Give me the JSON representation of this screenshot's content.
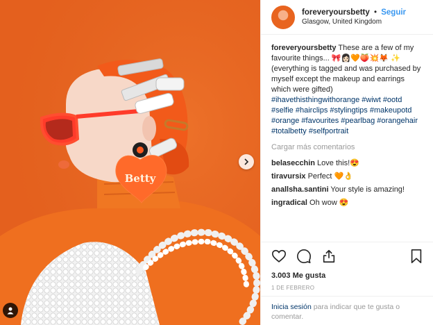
{
  "header": {
    "username": "foreveryoursbetty",
    "separator": "•",
    "follow_label": "Seguir",
    "location": "Glasgow, United Kingdom"
  },
  "caption": {
    "username": "foreveryoursbetty",
    "text": "These are a few of my favourite things... 🎀👩🏻🧡🍑💥🦊 ✨ (everything is tagged and was purchased by myself except the makeup and earrings which were gifted)",
    "hashtags": "#ihavethisthingwithorange #wiwt #ootd #selfie #hairclips #stylingtips #makeupotd #orange #favourites #pearlbag #orangehair #totalbetty #selfportrait"
  },
  "load_more_label": "Cargar más comentarios",
  "comments": [
    {
      "user": "belasecchin",
      "text": "Love this!😍"
    },
    {
      "user": "tiravursix",
      "text": "Perfect 🧡👌"
    },
    {
      "user": "anallsha.santini",
      "text": "Your style is amazing!"
    },
    {
      "user": "ingradical",
      "text": "Oh wow 😍"
    }
  ],
  "likes": "3.003 Me gusta",
  "date": "1 DE FEBRERO",
  "login": {
    "link": "Inicia sesión",
    "rest": " para indicar que te gusta o comentar."
  },
  "photo": {
    "earring_text": "Betty",
    "background_color": "#e8641f"
  },
  "icons": {
    "heart": "heart-icon",
    "comment": "comment-icon",
    "share": "share-icon",
    "save": "bookmark-icon",
    "next": "chevron-right-icon",
    "user_tag": "user-icon"
  },
  "colors": {
    "accent": "#3897f0",
    "hashtag": "#003569",
    "muted": "#999999"
  }
}
